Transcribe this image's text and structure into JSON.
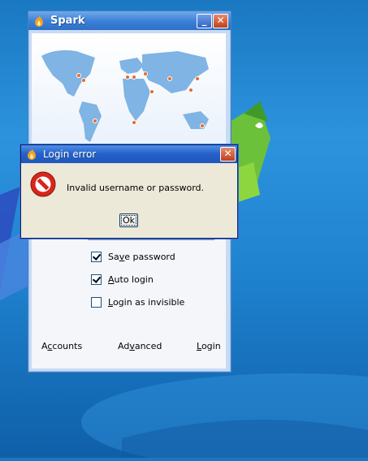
{
  "spark_window": {
    "title": "Spark",
    "minimize_label": "_",
    "close_label": "✕",
    "options": [
      {
        "label_pre": "Sa",
        "label_u": "v",
        "label_post": "e password",
        "checked": true
      },
      {
        "label_pre": "",
        "label_u": "A",
        "label_post": "uto login",
        "checked": true
      },
      {
        "label_pre": "",
        "label_u": "L",
        "label_post": "ogin as invisible",
        "checked": false
      }
    ],
    "links": {
      "accounts": {
        "pre": "A",
        "u": "c",
        "post": "counts"
      },
      "advanced": {
        "pre": "Ad",
        "u": "v",
        "post": "anced"
      },
      "login": {
        "pre": "",
        "u": "L",
        "post": "ogin"
      }
    }
  },
  "error_dialog": {
    "title": "Login error",
    "close_label": "✕",
    "message": "Invalid username or password.",
    "ok_label": "Ok"
  },
  "colors": {
    "titlebar": "#3a7fd6",
    "dialog_bg": "#ece9d8",
    "map_land": "#7fb4e4",
    "error_red": "#d8261c"
  }
}
